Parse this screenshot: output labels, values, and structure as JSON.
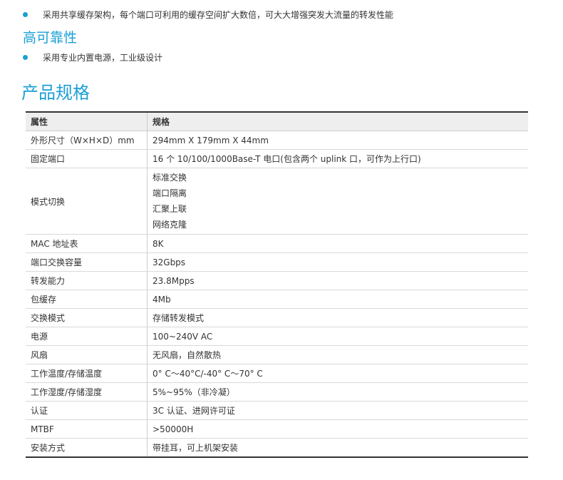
{
  "features": {
    "bullet1": "采用共享缓存架构，每个端口可利用的缓存空间扩大数倍，可大大增强突发大流量的转发性能",
    "heading_reliability": "高可靠性",
    "bullet2": "采用专业内置电源，工业级设计"
  },
  "spec": {
    "title": "产品规格",
    "headers": [
      "属性",
      "规格"
    ],
    "rows": [
      {
        "attr": "外形尺寸（W×H×D）mm",
        "values": [
          "294mm X 179mm X 44mm"
        ]
      },
      {
        "attr": "固定端口",
        "values": [
          "16 个 10/100/1000Base-T 电口(包含两个 uplink 口，可作为上行口)"
        ]
      },
      {
        "attr": "模式切换",
        "values": [
          "标准交换",
          "端口隔离",
          "汇聚上联",
          "网络克隆"
        ]
      },
      {
        "attr": "MAC 地址表",
        "values": [
          "8K"
        ]
      },
      {
        "attr": "端口交换容量",
        "values": [
          "32Gbps"
        ]
      },
      {
        "attr": "转发能力",
        "values": [
          "23.8Mpps"
        ]
      },
      {
        "attr": "包缓存",
        "values": [
          "4Mb"
        ]
      },
      {
        "attr": "交换模式",
        "values": [
          "存储转发模式"
        ]
      },
      {
        "attr": "电源",
        "values": [
          "100~240V AC"
        ]
      },
      {
        "attr": "风扇",
        "values": [
          "无风扇，自然散热"
        ]
      },
      {
        "attr": "工作温度/存储温度",
        "values": [
          "0° C～40°C/-40° C～70° C"
        ]
      },
      {
        "attr": "工作湿度/存储湿度",
        "values": [
          "5%~95%（非冷凝）"
        ]
      },
      {
        "attr": "认证",
        "values": [
          "3C 认证、进网许可证"
        ]
      },
      {
        "attr": "MTBF",
        "values": [
          ">50000H"
        ]
      },
      {
        "attr": "安装方式",
        "values": [
          "带挂耳，可上机架安装"
        ]
      }
    ]
  },
  "colors": {
    "accent": "#1a9fd5",
    "header_bg": "#eeeeee"
  }
}
